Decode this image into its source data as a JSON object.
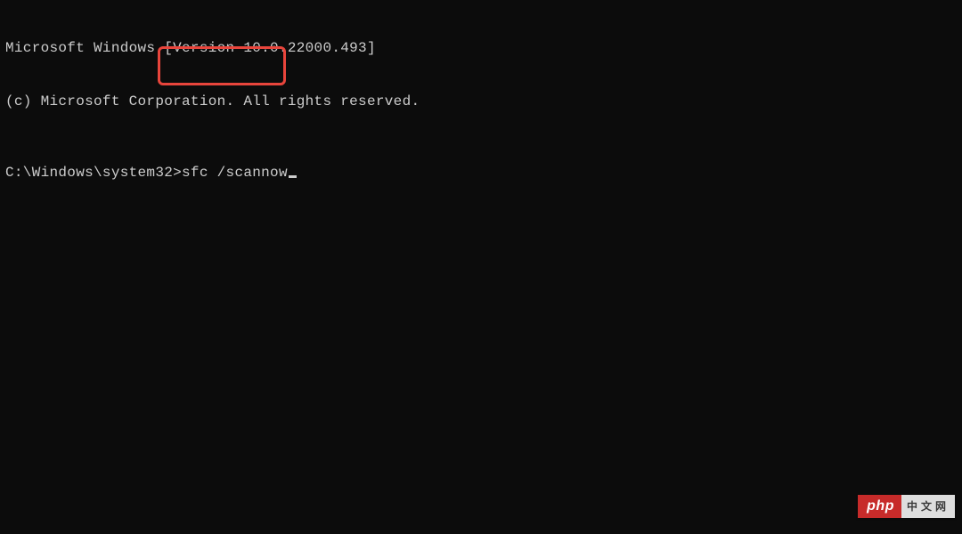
{
  "terminal": {
    "header_line1": "Microsoft Windows [Version 10.0.22000.493]",
    "header_line2": "(c) Microsoft Corporation. All rights reserved.",
    "prompt": "C:\\Windows\\system32>",
    "command": "sfc /scannow"
  },
  "watermark": {
    "left": "php",
    "right": "中文网"
  },
  "annotation": {
    "highlight_color": "#e8453c"
  }
}
